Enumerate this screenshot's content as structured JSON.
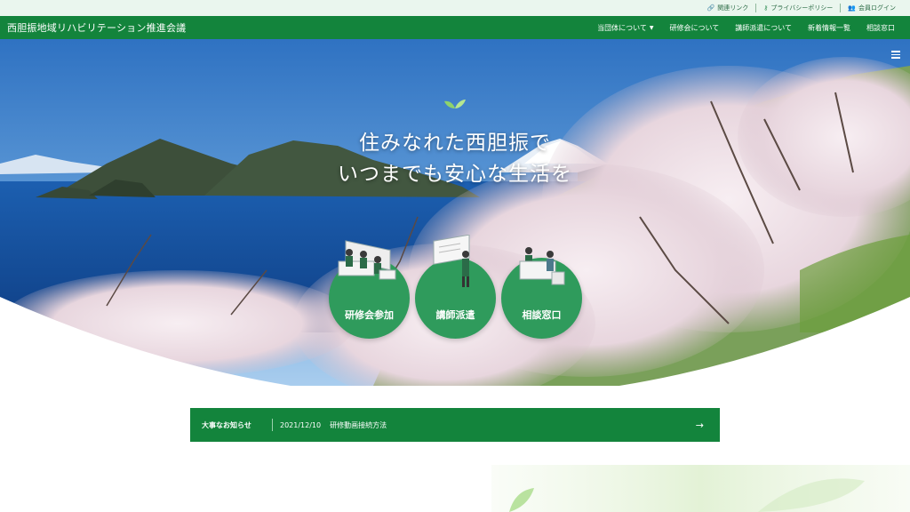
{
  "utility_links": [
    {
      "label": "関連リンク",
      "icon": "link-icon"
    },
    {
      "label": "プライバシーポリシー",
      "icon": "key-icon"
    },
    {
      "label": "会員ログイン",
      "icon": "users-icon"
    }
  ],
  "header": {
    "site_title": "西胆振地域リハビリテーション推進会議",
    "nav": [
      {
        "label": "当団体について",
        "has_dropdown": true
      },
      {
        "label": "研修会について"
      },
      {
        "label": "講師派遣について"
      },
      {
        "label": "新着情報一覧"
      },
      {
        "label": "相談窓口"
      }
    ]
  },
  "hero": {
    "catch_line1": "住みなれた西胆振で",
    "catch_line2": "いつまでも安心な生活を",
    "cta": [
      {
        "label": "研修会参加",
        "icon": "seminar-icon"
      },
      {
        "label": "講師派遣",
        "icon": "lecturer-icon"
      },
      {
        "label": "相談窓口",
        "icon": "consultation-icon"
      }
    ]
  },
  "notice": {
    "label": "大事なお知らせ",
    "date": "2021/12/10",
    "title": "研修動画接続方法",
    "icon": "arrow-right-icon"
  },
  "colors": {
    "brand_green": "#13843c",
    "cta_green": "#2f9b5c",
    "util_bg": "#eaf6ee"
  }
}
